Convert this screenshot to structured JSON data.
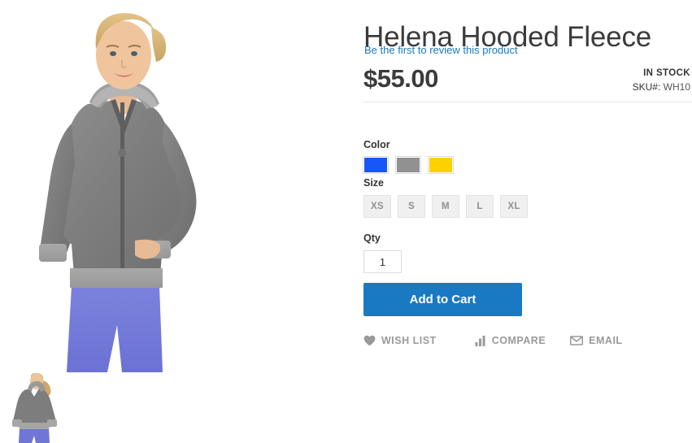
{
  "product": {
    "title": "Helena Hooded Fleece",
    "review_link": "Be the first to review this product",
    "price": "$55.00",
    "stock_status": "IN STOCK",
    "sku_label": "SKU#:",
    "sku_value": "WH10"
  },
  "options": {
    "color": {
      "label": "Color",
      "swatches": [
        {
          "name": "blue",
          "hex": "#1857f7"
        },
        {
          "name": "gray",
          "hex": "#919191"
        },
        {
          "name": "yellow",
          "hex": "#ffd100"
        }
      ]
    },
    "size": {
      "label": "Size",
      "swatches": [
        "XS",
        "S",
        "M",
        "L",
        "XL"
      ]
    },
    "qty": {
      "label": "Qty",
      "value": "1"
    }
  },
  "cart": {
    "add_to_cart_label": "Add to Cart"
  },
  "actions": [
    {
      "icon": "heart-icon",
      "label": "WISH LIST"
    },
    {
      "icon": "compare-bars-icon",
      "label": "COMPARE"
    },
    {
      "icon": "envelope-icon",
      "label": "EMAIL"
    }
  ],
  "gallery": {
    "main_image_alt": "Woman wearing gray Helena hooded fleece with blue leggings",
    "thumbnail_alt": "Back view of gray Helena hooded fleece",
    "next_arrow": "chevron-right-icon"
  },
  "colors": {
    "accent_blue": "#1979c3",
    "title_gray": "#3b3b3b",
    "muted_gray": "#9a9a9a",
    "divider": "#e8e8e8"
  }
}
